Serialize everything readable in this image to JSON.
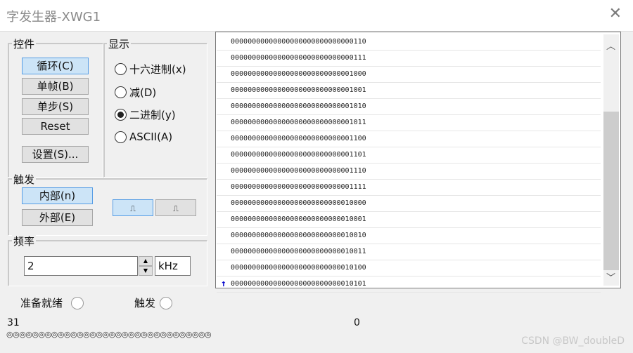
{
  "window": {
    "title": "字发生器-XWG1",
    "close_icon": "close-icon"
  },
  "controls": {
    "label": "控件",
    "cycle": "循环(C)",
    "burst": "单帧(B)",
    "step": "单步(S)",
    "reset": "Reset",
    "settings": "设置(S)..."
  },
  "display": {
    "label": "显示",
    "hex": "十六进制(x)",
    "dec": "减(D)",
    "bin": "二进制(y)",
    "ascii": "ASCII(A)"
  },
  "trigger": {
    "label": "触发",
    "internal": "内部(n)",
    "external": "外部(E)",
    "rising_icon": "rising-edge-icon",
    "falling_icon": "falling-edge-icon"
  },
  "frequency": {
    "label": "频率",
    "value": "2",
    "unit": "kHz"
  },
  "data_rows": [
    "00000000000000000000000000000110",
    "00000000000000000000000000000111",
    "00000000000000000000000000001000",
    "00000000000000000000000000001001",
    "00000000000000000000000000001010",
    "00000000000000000000000000001011",
    "00000000000000000000000000001100",
    "00000000000000000000000000001101",
    "00000000000000000000000000001110",
    "00000000000000000000000000001111",
    "00000000000000000000000000010000",
    "00000000000000000000000000010001",
    "00000000000000000000000000010010",
    "00000000000000000000000000010011",
    "00000000000000000000000000010100",
    "00000000000000000000000000010101"
  ],
  "status": {
    "ready": "准备就绪",
    "trigger": "触发"
  },
  "bits": {
    "high": "31",
    "low": "0",
    "pins": "◎◎◎◎◎◎◎◎◎◎◎◎◎◎◎◎◎◎◎◎◎◎◎◎◎◎◎◎◎◎◎◎"
  },
  "watermark": "CSDN @BW_doubleD"
}
